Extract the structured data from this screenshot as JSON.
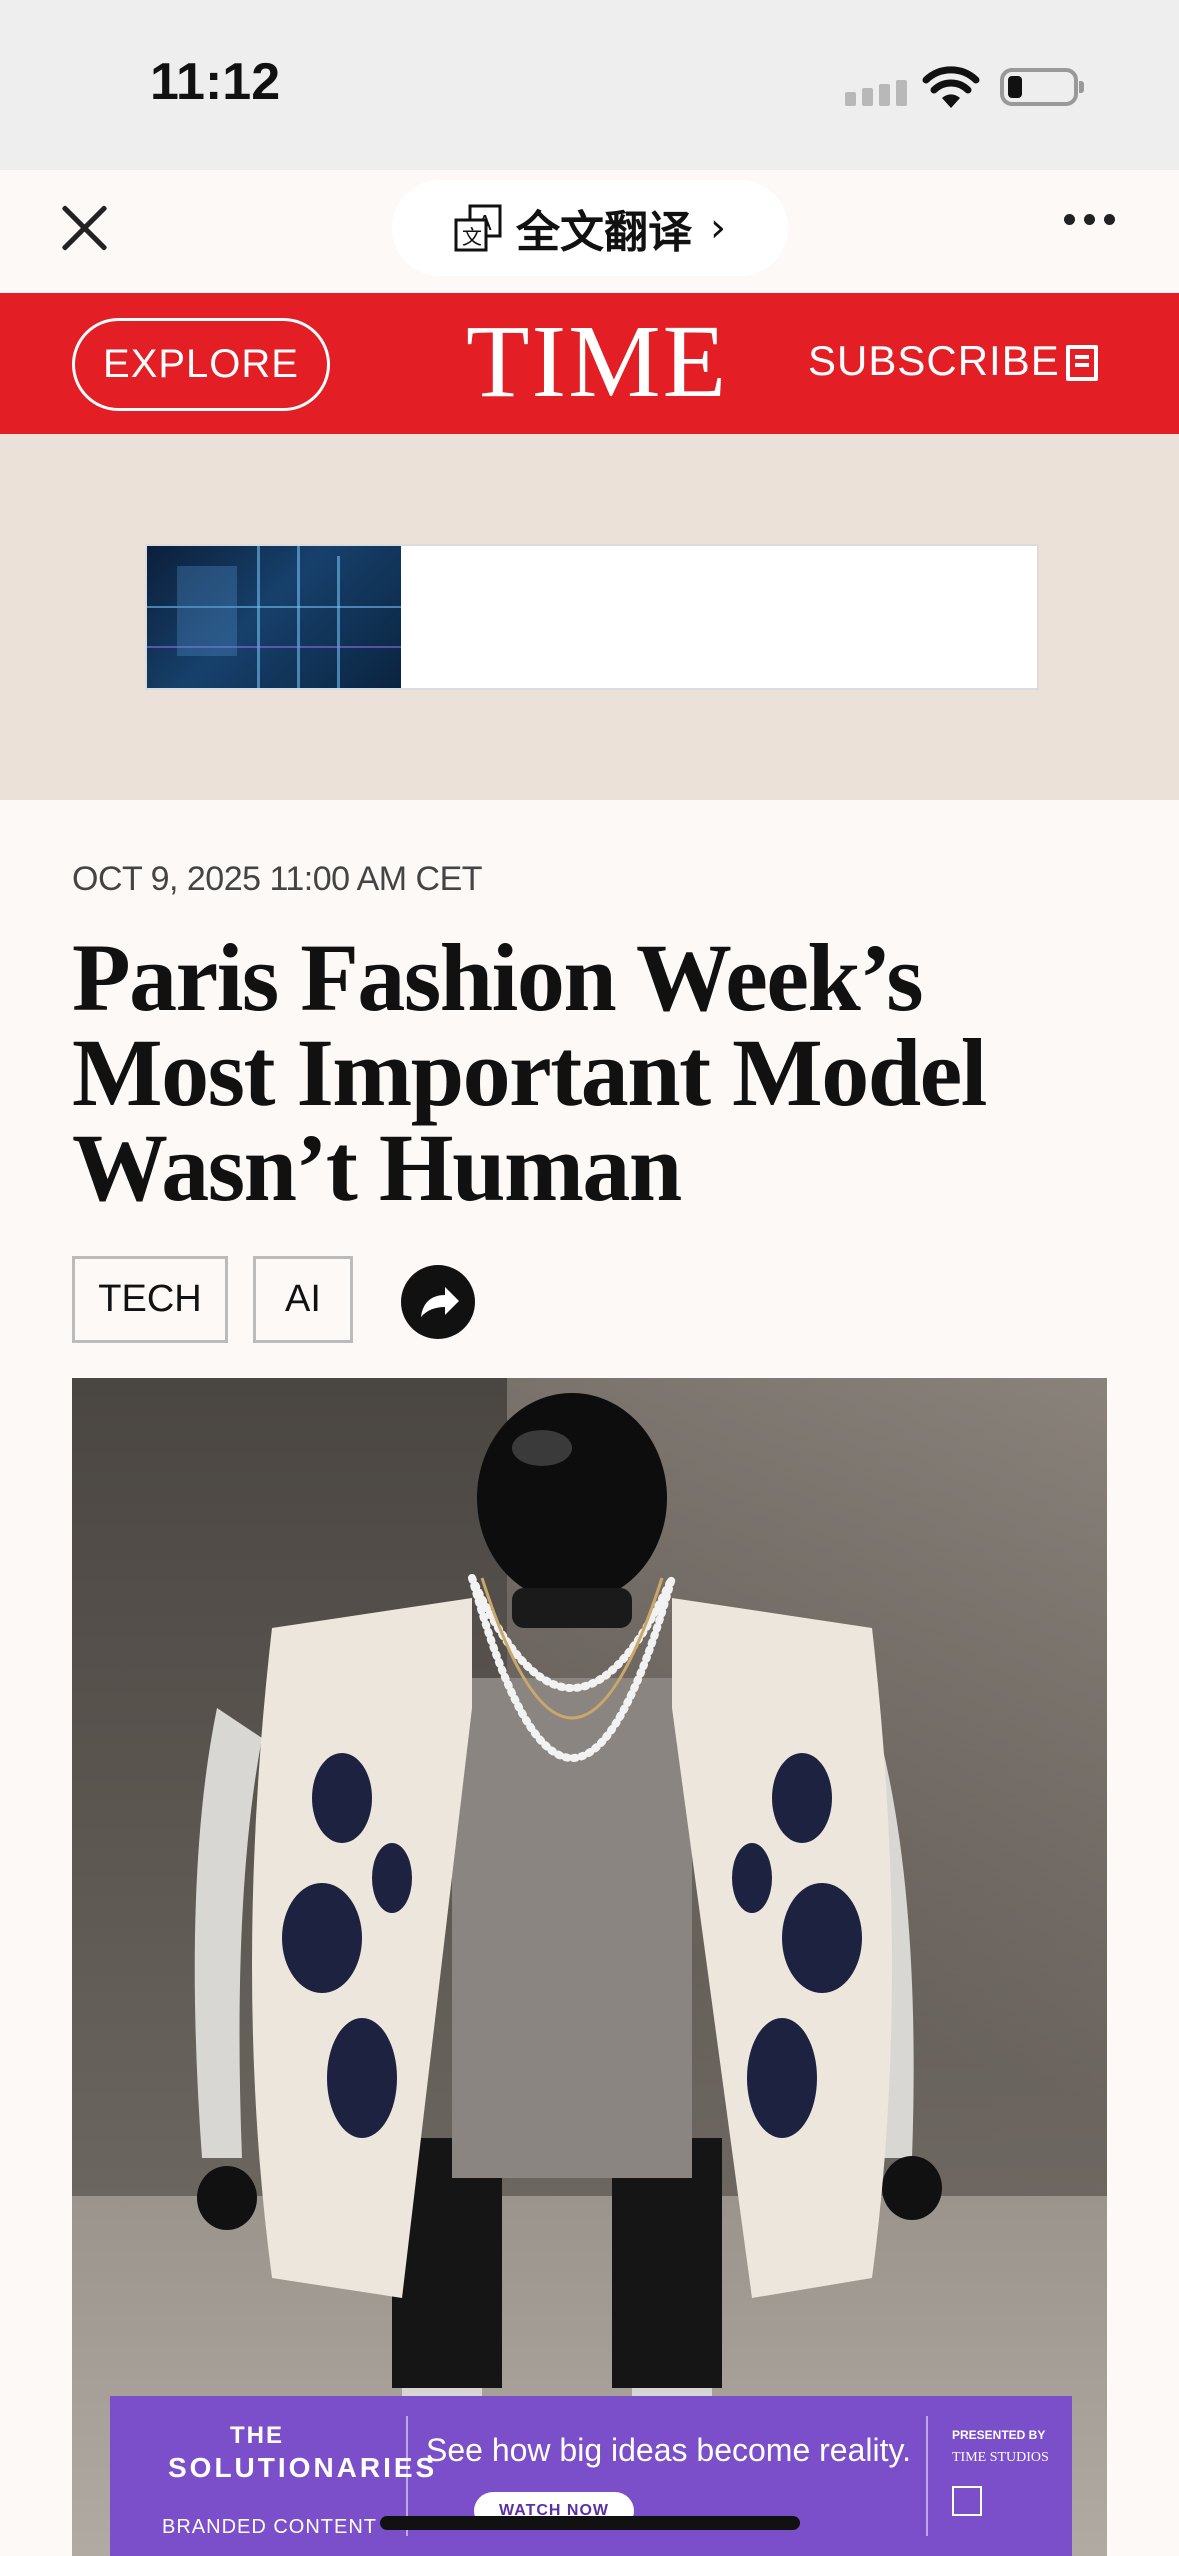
{
  "status_bar": {
    "time": "11:12"
  },
  "browser": {
    "translate_label": "全文翻译",
    "translate_chevron": "›"
  },
  "header": {
    "explore_label": "EXPLORE",
    "logo": "TIME",
    "subscribe_label": "SUBSCRIBE",
    "brand_color": "#e31e24"
  },
  "article": {
    "dateline": "OCT 9, 2025 11:00 AM CET",
    "headline": "Paris Fashion Week’s Most Important Model Wasn’t Human",
    "tags": [
      "TECH",
      "AI"
    ]
  },
  "sponsor_ad": {
    "logo_line1": "THE",
    "logo_line2": "SOLUTIONARIES",
    "branded_content": "BRANDED CONTENT",
    "tagline": "See how big ideas become reality.",
    "cta": "WATCH NOW",
    "presented_by": "PRESENTED BY",
    "presenter_1": "TIME STUDIOS",
    "accent_color": "#7b4fc9"
  },
  "icons": {
    "close": "close-icon",
    "translate": "translate-icon",
    "more": "more-icon",
    "subscribe": "newspaper-icon",
    "share": "share-icon"
  }
}
